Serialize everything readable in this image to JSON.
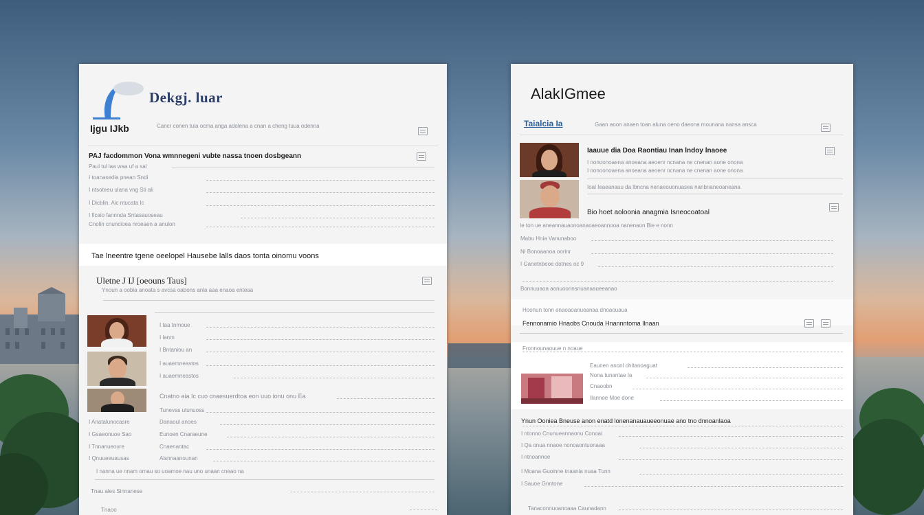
{
  "doc1": {
    "brand": "Dekgj. luar",
    "heading": "Ijgu IJkb",
    "header_line": "Cancr conen tuia ocma anga adolena a cnan a cheng tuua odenna",
    "row1": "PAJ facdommon Vona wmnnegeni vubte nassa tnoen dosbgeann",
    "row2": "Paul tul laa waa uf a sal",
    "list1": [
      "I toanasedia pnean Sndi",
      "I ntsoteeu ulana vng Sti ali",
      "I Dicblin. Aic ntucata Ic",
      "I ficaio fannnda Sntasauoseau"
    ],
    "list1_tail": "Cnolin cnuncioea nroeaen a anulon",
    "banner": "Tae lneentre tgene oeelopel Hausebe lalls daos tonta oinomu voons",
    "section2_title": "Uletne J IJ [oeouns Taus]",
    "section2_sub": "Ynoun a oobia anoata s avcsa oabons anla aaa enaoa enteaa",
    "people_rows": [
      "I taa tnmoue",
      "I lanm",
      "I Bntaniou an",
      "I auaemneastos"
    ],
    "people_tail_1": "Cnatno aia Ic cuo cnaesuerdtoa eon uuo ionu onu Ea",
    "people_tail_2": "Tunevas utunuoss",
    "list2": [
      "I Anatalunocasre",
      "I Gsaeonuoe Sao",
      "I Tnnanueoure",
      "I Qnuueeuausas"
    ],
    "list2_right": [
      "Danaoul anoes",
      "Eunoen Cnaraeune",
      "Cnaenantac",
      "Alsnnaanounan"
    ],
    "footer_line": "I nanna ue nnam omau so uoamoe nau uno unaan cneao na",
    "footer_left": "Tnau ales Sinnanese",
    "footer_bottom": "Tnaoo"
  },
  "doc2": {
    "title": "AlakIGmee",
    "sub_title": "Taialcia Ia",
    "header_line": "Gaan aoon anaen toan aluna oeno daeona mounana nansa ansca",
    "person_title": "Iaauue dia Doa Raontiau Inan lndoy lnaoee",
    "person_line1": "I nonoonoaena anoeana aeoenr ncnana ne cnenan aone onona",
    "person_line2": "Ioal Ieaeanauu da lbncna nenaeouonuasea nanbnaneoaneana",
    "person_section": "Bio hoet aoloonia anagmia Isneocoatoal",
    "person_section_sub": "Ie ton ue aneannauaonoanaoaeoannooa nanenaon Bie e nonn",
    "list1": [
      "Mabu Hnia Vanunaboo",
      "Ni Bonoaanoa oorinr",
      "I Ganetnbeoe dotnes oc 9"
    ],
    "list1_tail": "Bonnuuaoa aonuoonnsnuanaaueeanao",
    "band_line": "Hoonun tonn anaoaoanueanaa dnoaouaua",
    "band_title": "Fennonamio Hnaobs Cnouda Hnannntoma Ilnaan",
    "section2_head": "Fronnounaouue n noaue",
    "section2_rows": [
      "Nona tunantae Ia",
      "Eaunen anonl ohitanoaguat",
      "Cnaoobn",
      "Ilannoe Moe done"
    ],
    "section3_line": "Ynun Ooniea Bneuse anon  enatd lonenanauaueeonuae ano tno dnnoanlaoa",
    "list2": [
      "I ntonno Cnunueannaonu Conoai",
      "I Qa onua nnaoe nonoaontuonaaa",
      "I ntnoannoe",
      "I Moana Guoinne tnaania nuaa Tunn",
      "I Sauoe Gnntone"
    ],
    "footer": "Tanaconnuoanoaaa Caunadann"
  },
  "colors": {
    "brand_blue": "#2c3e66",
    "accent_blue": "#3d7fd0"
  }
}
